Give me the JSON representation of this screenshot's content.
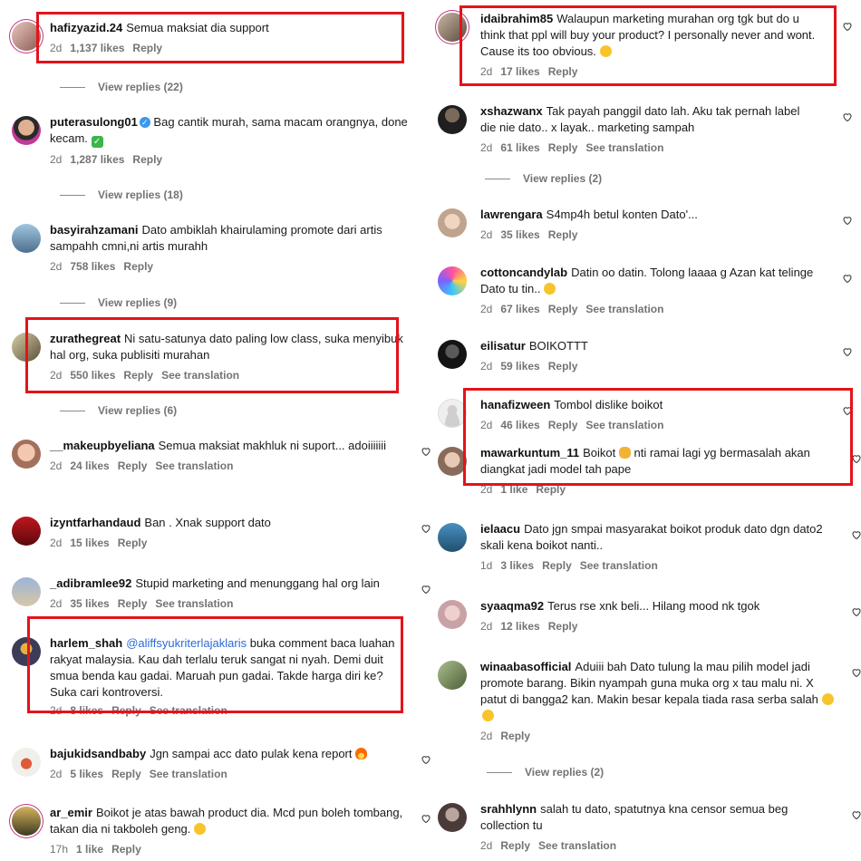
{
  "labels": {
    "reply": "Reply",
    "see_translation": "See translation"
  },
  "left": [
    {
      "username": "hafizyazid.24",
      "text": "Semua maksiat dia support",
      "time": "2d",
      "likes": "1,137 likes",
      "replies": "View replies (22)"
    },
    {
      "username": "puterasulong01",
      "verified": true,
      "text": "Bag cantik murah, sama macam orangnya, done kecam.",
      "time": "2d",
      "likes": "1,287 likes",
      "replies": "View replies (18)"
    },
    {
      "username": "basyirahzamani",
      "text": "Dato ambiklah khairulaming promote dari artis sampahh cmni,ni artis murahh",
      "time": "2d",
      "likes": "758 likes",
      "replies": "View replies (9)"
    },
    {
      "username": "zurathegreat",
      "text": "Ni satu-satunya dato paling low class, suka menyibuk hal org, suka publisiti murahan",
      "time": "2d",
      "likes": "550 likes",
      "replies": "View replies (6)"
    },
    {
      "username": "__makeupbyeliana",
      "text": "Semua maksiat makhluk ni suport... adoiiiiiii",
      "time": "2d",
      "likes": "24 likes"
    },
    {
      "username": "izyntfarhandaud",
      "text": "Ban . Xnak support dato",
      "time": "2d",
      "likes": "15 likes"
    },
    {
      "username": "_adibramlee92",
      "text": "Stupid marketing and menunggang hal org lain",
      "time": "2d",
      "likes": "35 likes"
    },
    {
      "username": "harlem_shah",
      "mention": "@aliffsyukriterlajaklaris",
      "text": "buka comment baca luahan rakyat malaysia. Kau dah terlalu teruk sangat ni nyah. Demi duit smua benda kau gadai. Maruah pun gadai. Takde harga diri ke? Suka cari kontroversi.",
      "time": "2d",
      "likes": "8 likes"
    },
    {
      "username": "bajukidsandbaby",
      "text": "Jgn sampai acc dato pulak kena report",
      "time": "2d",
      "likes": "5 likes"
    },
    {
      "username": "ar_emir",
      "text": "Boikot je atas bawah product dia. Mcd pun boleh tombang, takan dia ni takboleh geng.",
      "time": "17h",
      "likes": "1 like"
    }
  ],
  "right": [
    {
      "username": "idaibrahim85",
      "text": "Walaupun marketing murahan org tgk but do u think that ppl will buy your product? I personally never and wont. Cause its too obvious.",
      "time": "2d",
      "likes": "17 likes"
    },
    {
      "username": "xshazwanx",
      "text": "Tak payah panggil dato lah. Aku tak pernah label die nie dato.. x layak.. marketing sampah",
      "time": "2d",
      "likes": "61 likes",
      "replies": "View replies (2)"
    },
    {
      "username": "lawrengara",
      "text": "S4mp4h betul konten Dato'...",
      "time": "2d",
      "likes": "35 likes"
    },
    {
      "username": "cottoncandylab",
      "text": "Datin oo datin. Tolong laaaa g Azan kat telinge Dato tu tin..",
      "time": "2d",
      "likes": "67 likes"
    },
    {
      "username": "eilisatur",
      "text": "BOIKOTTT",
      "time": "2d",
      "likes": "59 likes"
    },
    {
      "username": "hanafizween",
      "text": "Tombol dislike boikot",
      "time": "2d",
      "likes": "46 likes"
    },
    {
      "username": "mawarkuntum_11",
      "text": "Boikot",
      "text2": "nti ramai lagi yg bermasalah akan diangkat jadi model tah pape",
      "time": "2d",
      "likes": "1 like"
    },
    {
      "username": "ielaacu",
      "text": "Dato jgn smpai masyarakat boikot produk dato dgn dato2 skali kena boikot nanti..",
      "time": "1d",
      "likes": "3 likes"
    },
    {
      "username": "syaaqma92",
      "text": "Terus rse xnk beli... Hilang mood nk tgok",
      "time": "2d",
      "likes": "12 likes"
    },
    {
      "username": "winaabasofficial",
      "text": "Aduiii bah Dato tulung la mau pilih model jadi promote barang. Bikin nyampah guna muka org x tau malu ni. X patut di bangga2 kan. Makin besar kepala tiada rasa serba salah",
      "time": "2d",
      "replies": "View replies (2)"
    },
    {
      "username": "srahhlynn",
      "text": "salah tu dato, spatutnya kna censor semua beg collection tu",
      "time": "2d"
    }
  ]
}
